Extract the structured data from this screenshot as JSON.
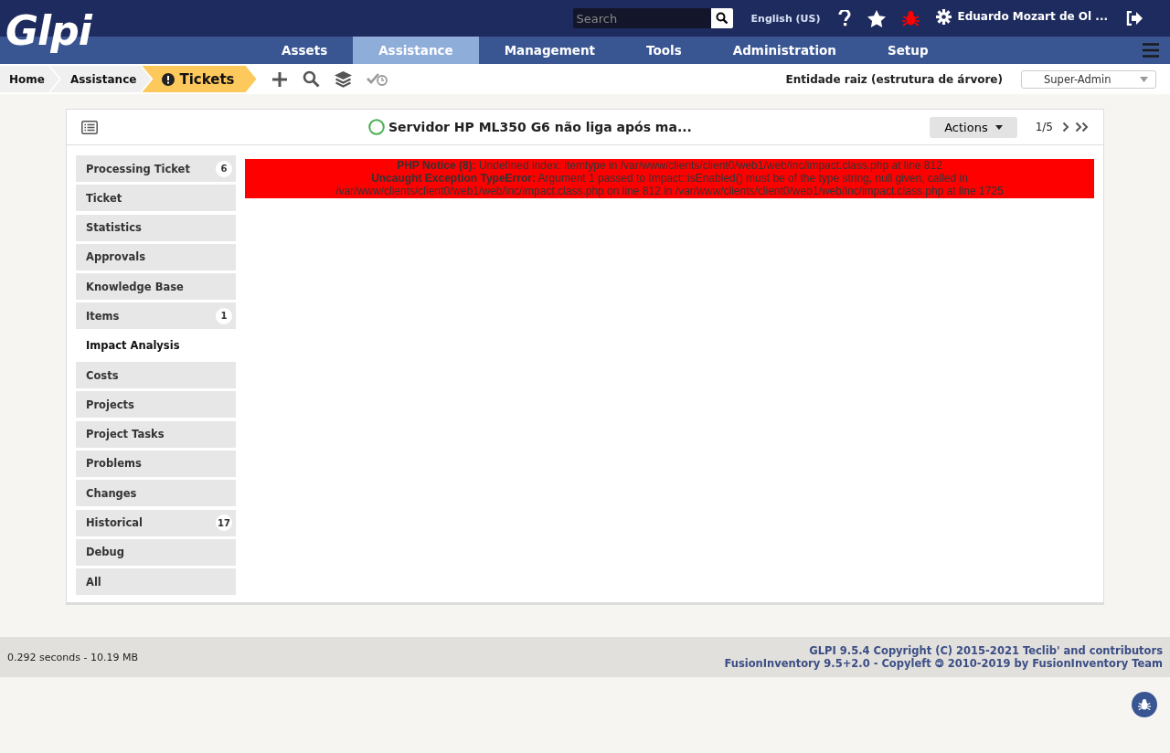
{
  "logo": "Glpi",
  "search": {
    "placeholder": "Search"
  },
  "language": "English (US)",
  "user": "Eduardo Mozart de Ol ...",
  "menu": [
    {
      "label": "Assets",
      "selected": false
    },
    {
      "label": "Assistance",
      "selected": true
    },
    {
      "label": "Management",
      "selected": false
    },
    {
      "label": "Tools",
      "selected": false
    },
    {
      "label": "Administration",
      "selected": false
    },
    {
      "label": "Setup",
      "selected": false
    }
  ],
  "breadcrumbs": [
    "Home",
    "Assistance",
    "Tickets"
  ],
  "entity": "Entidade raiz (estrutura de árvore)",
  "profile": "Super-Admin",
  "ticket": {
    "title": "Servidor HP ML350 G6 não liga após ma...",
    "actions": "Actions",
    "pager": "1/5"
  },
  "tabs": [
    {
      "label": "Processing Ticket",
      "count": "6",
      "selected": false
    },
    {
      "label": "Ticket",
      "selected": false
    },
    {
      "label": "Statistics",
      "selected": false
    },
    {
      "label": "Approvals",
      "selected": false
    },
    {
      "label": "Knowledge Base",
      "selected": false
    },
    {
      "label": "Items",
      "count": "1",
      "selected": false
    },
    {
      "label": "Impact Analysis",
      "selected": true
    },
    {
      "label": "Costs",
      "selected": false
    },
    {
      "label": "Projects",
      "selected": false
    },
    {
      "label": "Project Tasks",
      "selected": false
    },
    {
      "label": "Problems",
      "selected": false
    },
    {
      "label": "Changes",
      "selected": false
    },
    {
      "label": "Historical",
      "count": "17",
      "selected": false
    },
    {
      "label": "Debug",
      "selected": false
    },
    {
      "label": "All",
      "selected": false
    }
  ],
  "errors": [
    "**PHP Notice (8):** Undefined index: itemtype in /var/www/clients/client0/web1/web/inc/impact.class.php at line 812",
    "**Uncaught Exception TypeError:** Argument 1 passed to Impact::isEnabled() must be of the type string, null given, called in /var/www/clients/client0/web1/web/inc/impact.class.php on line 812 in /var/www/clients/client0/web1/web/inc/impact.class.php at line 1725"
  ],
  "footer": {
    "timing": "0.292 seconds - 10.19 MB",
    "copyright": [
      "GLPI 9.5.4 Copyright (C) 2015-2021 Teclib' and contributors",
      "FusionInventory 9.5+2.0 - Copyleft 🄯 2010-2019 by FusionInventory Team"
    ]
  }
}
